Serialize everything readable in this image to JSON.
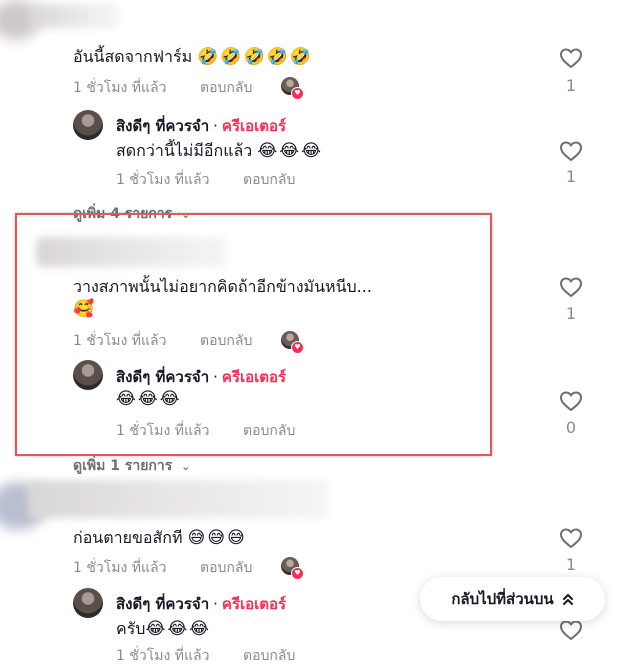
{
  "comments": [
    {
      "text": "อันนี้สดจากฟาร์ม",
      "emoji": "🤣🤣🤣🤣🤣",
      "time": "1 ชั่วโมง ที่แล้ว",
      "reply_label": "ตอบกลับ",
      "likes": "1",
      "reply": {
        "author": "สิงดีๆ ที่ควรจำ",
        "separator": "·",
        "creator_label": "ครีเอเตอร์",
        "text": "สดกว่านี้ไม่มีอีกแล้ว",
        "emoji": "😂😂😂",
        "time": "1 ชั่วโมง ที่แล้ว",
        "reply_label": "ตอบกลับ",
        "likes": "1"
      },
      "more": "ดูเพิ่ม 4 รายการ"
    },
    {
      "text": "วางสภาพนั้นไม่อยากคิดถ้าอีกข้างมันหนีบ...",
      "emoji": "🥰",
      "time": "1 ชั่วโมง ที่แล้ว",
      "reply_label": "ตอบกลับ",
      "likes": "1",
      "reply": {
        "author": "สิงดีๆ ที่ควรจำ",
        "separator": "·",
        "creator_label": "ครีเอเตอร์",
        "text": "",
        "emoji": "😂😂😂",
        "time": "1 ชั่วโมง ที่แล้ว",
        "reply_label": "ตอบกลับ",
        "likes": "0"
      },
      "more": "ดูเพิ่ม 1 รายการ"
    },
    {
      "text": "ก่อนตายขอสักที",
      "emoji": "😅😅😅",
      "time": "1 ชั่วโมง ที่แล้ว",
      "reply_label": "ตอบกลับ",
      "likes": "1",
      "reply": {
        "author": "สิงดีๆ ที่ควรจำ",
        "separator": "·",
        "creator_label": "ครีเอเตอร์",
        "text": "ครับ",
        "emoji": "😂😂😂",
        "time": "1 ชั่วโมง ที่แล้ว",
        "reply_label": "ตอบกลับ"
      }
    }
  ],
  "back_to_top": {
    "label": "กลับไปที่ส่วนบน",
    "icon": "chevron-double-up-icon"
  },
  "colors": {
    "creator": "#fe2c55",
    "highlight_border": "#e05a5a",
    "muted_text": "#8a8b91"
  }
}
